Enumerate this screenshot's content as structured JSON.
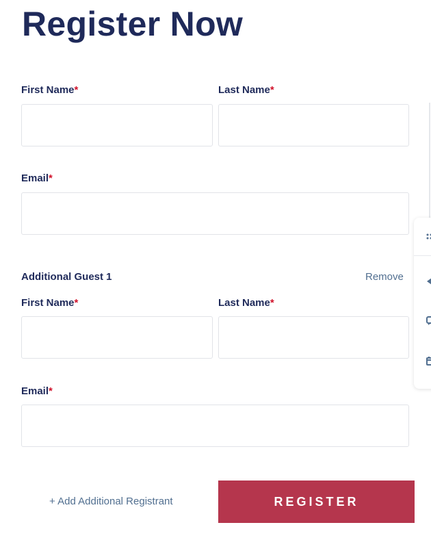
{
  "form": {
    "title": "Register Now",
    "required_mark": "*",
    "primary": {
      "first_name_label": "First Name",
      "last_name_label": "Last Name",
      "email_label": "Email",
      "first_name_value": "",
      "last_name_value": "",
      "email_value": ""
    },
    "guest": {
      "heading": "Additional Guest 1",
      "remove_label": "Remove",
      "first_name_label": "First Name",
      "last_name_label": "Last Name",
      "email_label": "Email",
      "first_name_value": "",
      "last_name_value": "",
      "email_value": ""
    },
    "add_registrant_label": "+ Add Additional Registrant",
    "register_label": "REGISTER"
  },
  "toolbar": {
    "icons": [
      "drag-handle-icon",
      "collapse-arrow-icon",
      "chat-icon",
      "calendar-icon"
    ]
  },
  "colors": {
    "heading": "#1f2a5a",
    "required": "#d1132b",
    "link": "#516f90",
    "button": "#b5364d",
    "border": "#e1e3e8"
  }
}
